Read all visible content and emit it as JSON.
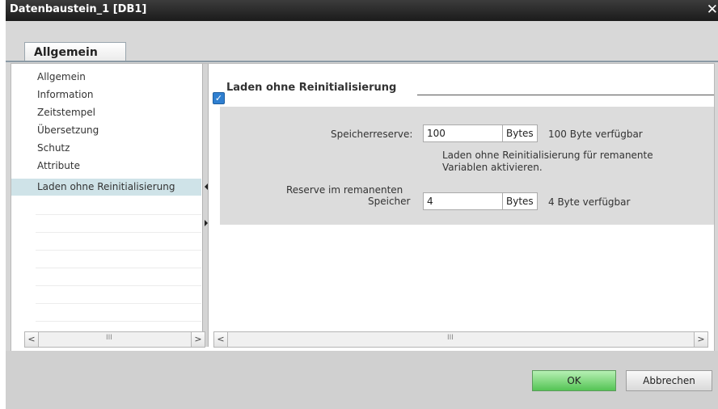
{
  "window": {
    "title": "Datenbaustein_1 [DB1]",
    "close_glyph": "✕"
  },
  "tab": {
    "label": "Allgemein"
  },
  "nav": {
    "items": [
      {
        "label": "Allgemein"
      },
      {
        "label": "Information"
      },
      {
        "label": "Zeitstempel"
      },
      {
        "label": "Übersetzung"
      },
      {
        "label": "Schutz"
      },
      {
        "label": "Attribute"
      },
      {
        "label": "Laden ohne Reinitialisierung",
        "selected": true
      }
    ]
  },
  "scrollbars": {
    "left_btn": "<",
    "right_btn": ">",
    "grip": "III"
  },
  "section": {
    "title": "Laden ohne Reinitialisierung",
    "speicherreserve": {
      "label": "Speicherreserve:",
      "value": "100",
      "unit": "Bytes",
      "available": "100 Byte verfügbar"
    },
    "checkbox": {
      "checked": true,
      "label_line1": "Laden ohne Reinitialisierung für remanente",
      "label_line2": "Variablen aktivieren."
    },
    "reserve_remanent": {
      "label_line1": "Reserve im remanenten",
      "label_line2": "Speicher",
      "value": "4",
      "unit": "Bytes",
      "available": "4 Byte verfügbar"
    }
  },
  "footer": {
    "ok_label": "OK",
    "cancel_label": "Abbrechen"
  },
  "colors": {
    "accent_ok": "#55c455",
    "selection": "#cfe3e8",
    "title_bar": "#1b1b1b"
  }
}
